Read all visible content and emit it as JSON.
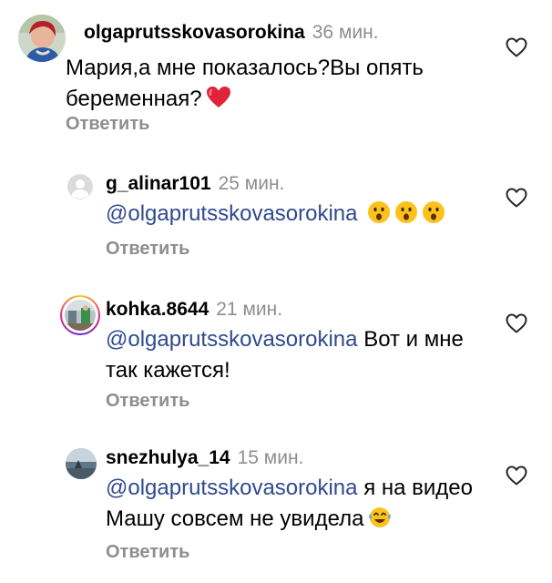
{
  "reply_label": "Ответить",
  "colors": {
    "mention": "#2f4a8f",
    "muted": "#8e8e8e",
    "heart_emoji": "#e0233a"
  },
  "comments": [
    {
      "username": "olgaprutsskovasorokina",
      "time": "36 мин.",
      "text": "Мария,а мне показалось?Вы опять беременная?",
      "emoji": "red-heart"
    },
    {
      "username": "g_alinar101",
      "time": "25 мин.",
      "mention": "@olgaprutsskovasorokina",
      "text": "",
      "emoji": "surprised-face x3"
    },
    {
      "username": "kohka.8644",
      "time": "21 мин.",
      "mention": "@olgaprutsskovasorokina",
      "text": "Вот и мне так кажется!"
    },
    {
      "username": "snezhulya_14",
      "time": "15 мин.",
      "mention": "@olgaprutsskovasorokina",
      "text": "я на видео Машу совсем не увидела",
      "emoji": "tears-of-joy"
    }
  ]
}
